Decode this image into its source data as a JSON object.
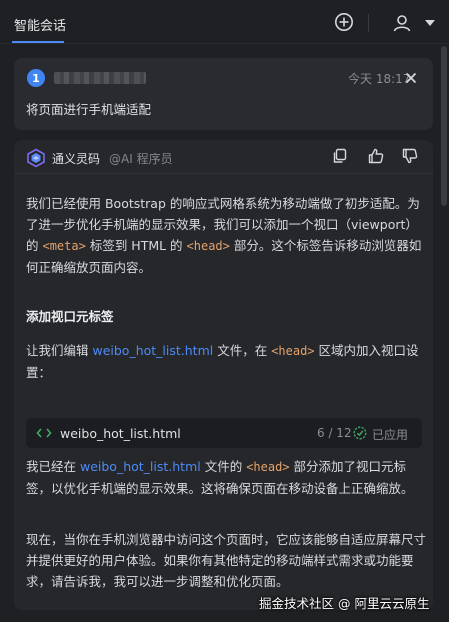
{
  "header": {
    "tab_title": "智能会话",
    "icons": [
      "plus-circle-icon",
      "user-icon",
      "caret-down-icon"
    ]
  },
  "user_message": {
    "avatar_number": "1",
    "time": "今天 18:17",
    "text": "将页面进行手机端适配",
    "close_icon": "close-icon"
  },
  "ai_message": {
    "assistant_name": "通义灵码",
    "assistant_role": "@AI 程序员",
    "actions": [
      "copy-icon",
      "thumbs-up-icon",
      "thumbs-down-icon"
    ],
    "p1": {
      "a": "我们已经使用 Bootstrap 的响应式网格系统为移动端做了初步适配。为了进一步优化手机端的显示效果，我们可以添加一个视口（viewport）的 ",
      "code1": "<meta>",
      "b": " 标签到 HTML 的 ",
      "code2": "<head>",
      "c": " 部分。这个标签告诉移动浏览器如何正确缩放页面内容。"
    },
    "heading": "添加视口元标签",
    "p2": {
      "a": "让我们编辑 ",
      "link": "weibo_hot_list.html",
      "b": " 文件，在 ",
      "code": "<head>",
      "c": " 区域内加入视口设置："
    },
    "file": {
      "name": "weibo_hot_list.html",
      "count": "6 / 12",
      "status": "已应用"
    },
    "p3": {
      "a": "我已经在 ",
      "link": "weibo_hot_list.html",
      "b": " 文件的 ",
      "code": "<head>",
      "c": " 部分添加了视口元标签，以优化手机端的显示效果。这将确保页面在移动设备上正确缩放。"
    },
    "p4": "现在，当你在手机浏览器中访问这个页面时，它应该能够自适应屏幕尺寸并提供更好的用户体验。如果你有其他特定的移动端样式需求或功能要求，请告诉我，我可以进一步调整和优化页面。"
  },
  "watermark": "掘金技术社区 @ 阿里云云原生",
  "colors": {
    "background": "#1f2023",
    "card": "#26272b",
    "accent_blue": "#4c8bf5",
    "code_orange": "#e4a26b"
  }
}
